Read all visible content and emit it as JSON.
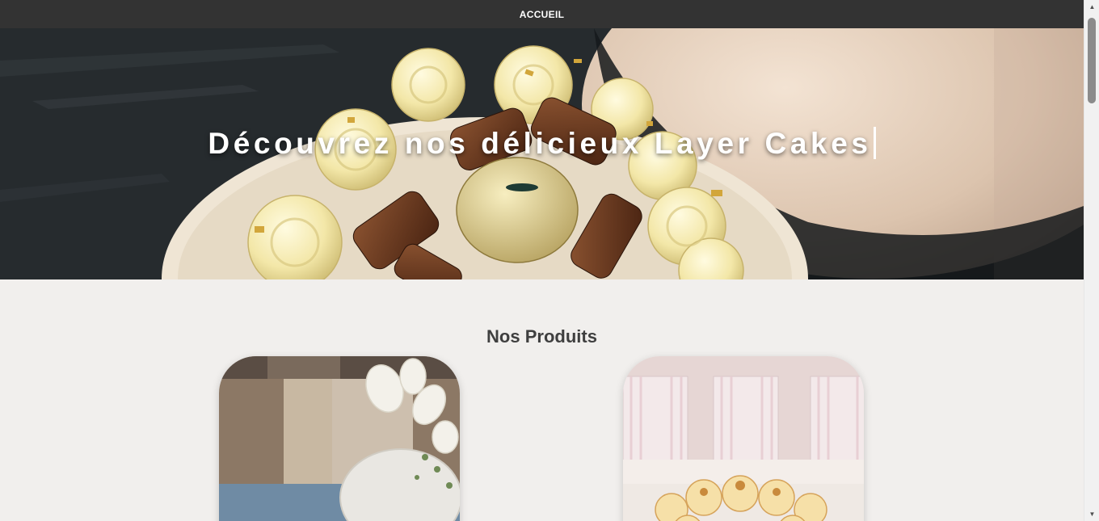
{
  "nav": {
    "home_label": "ACCUEIL"
  },
  "hero": {
    "title": "Découvrez nos délicieux Layer Cakes"
  },
  "products": {
    "heading": "Nos Produits"
  },
  "colors": {
    "nav_bg": "#333333",
    "page_bg": "#f1efed",
    "heading_text": "#3f3f3f"
  },
  "icons": {
    "scroll_up": "triangle-up",
    "scroll_down": "triangle-down"
  }
}
